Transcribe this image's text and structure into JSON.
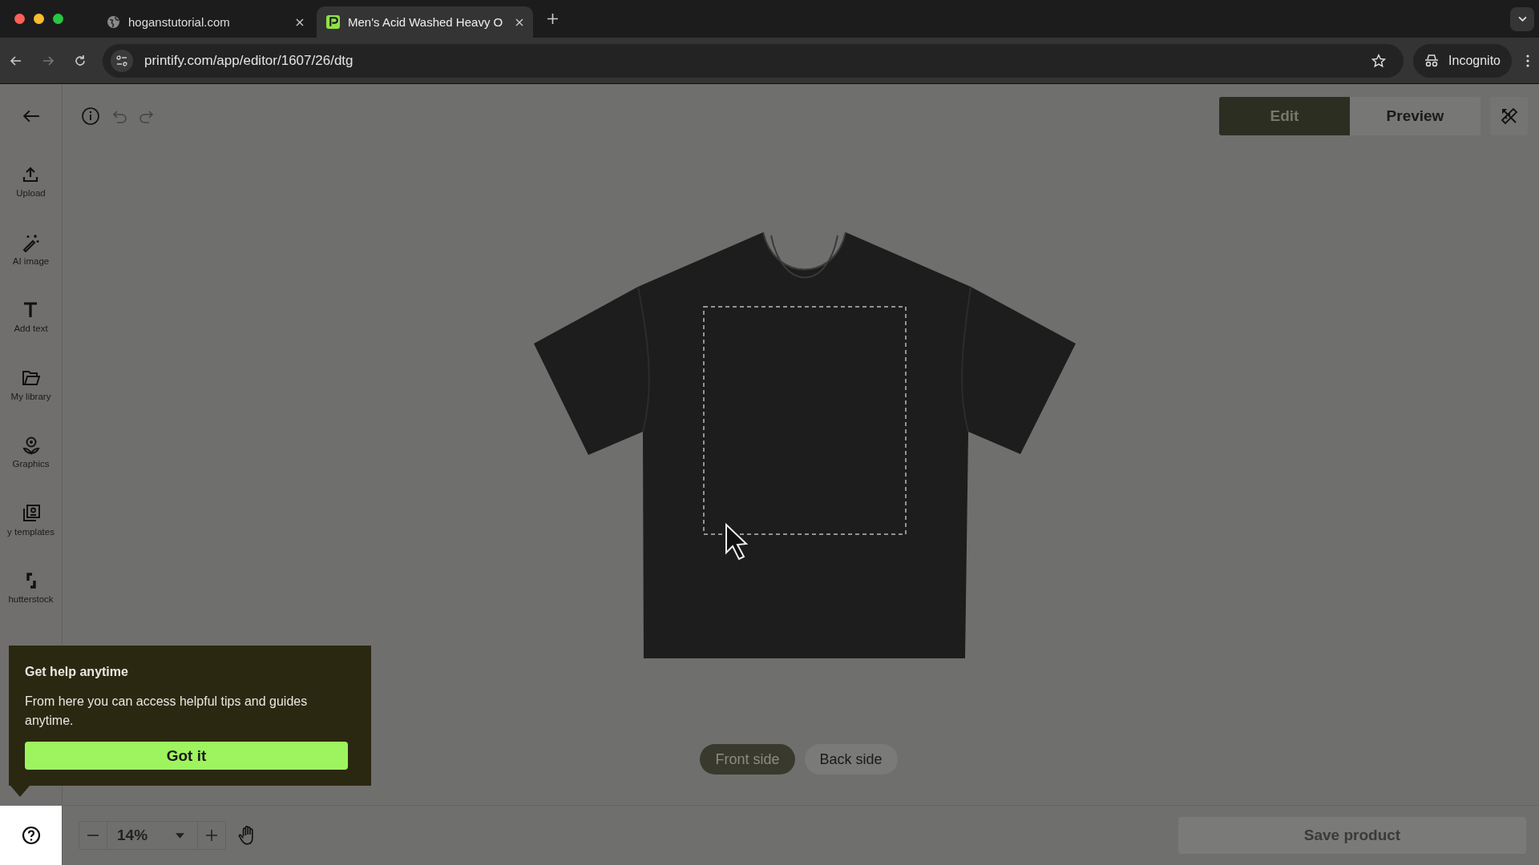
{
  "browser": {
    "tabs": [
      {
        "title": "hoganstutorial.com",
        "kind": "globe",
        "selected": false
      },
      {
        "title": "Men's Acid Washed Heavy O",
        "kind": "app",
        "selected": true
      }
    ],
    "address": "printify.com/app/editor/1607/26/dtg",
    "profile": "Incognito"
  },
  "sidebar": {
    "items": [
      {
        "label": "Upload",
        "kind": "upload"
      },
      {
        "label": "AI image",
        "kind": "ai"
      },
      {
        "label": "Add text",
        "kind": "text"
      },
      {
        "label": "My library",
        "kind": "library"
      },
      {
        "label": "Graphics",
        "kind": "graphics"
      },
      {
        "label": "y templates",
        "kind": "templates"
      },
      {
        "label": "hutterstock",
        "kind": "shutterstock"
      }
    ]
  },
  "mode_tabs": [
    {
      "label": "Edit",
      "selected": true
    },
    {
      "label": "Preview",
      "selected": false
    }
  ],
  "sides": [
    {
      "label": "Front side",
      "selected": true
    },
    {
      "label": "Back side",
      "selected": false
    }
  ],
  "zoom": "14%",
  "save_button": "Save product",
  "help_popup": {
    "title": "Get help anytime",
    "body": "From here you can access helpful tips and guides anytime.",
    "button": "Got it"
  }
}
